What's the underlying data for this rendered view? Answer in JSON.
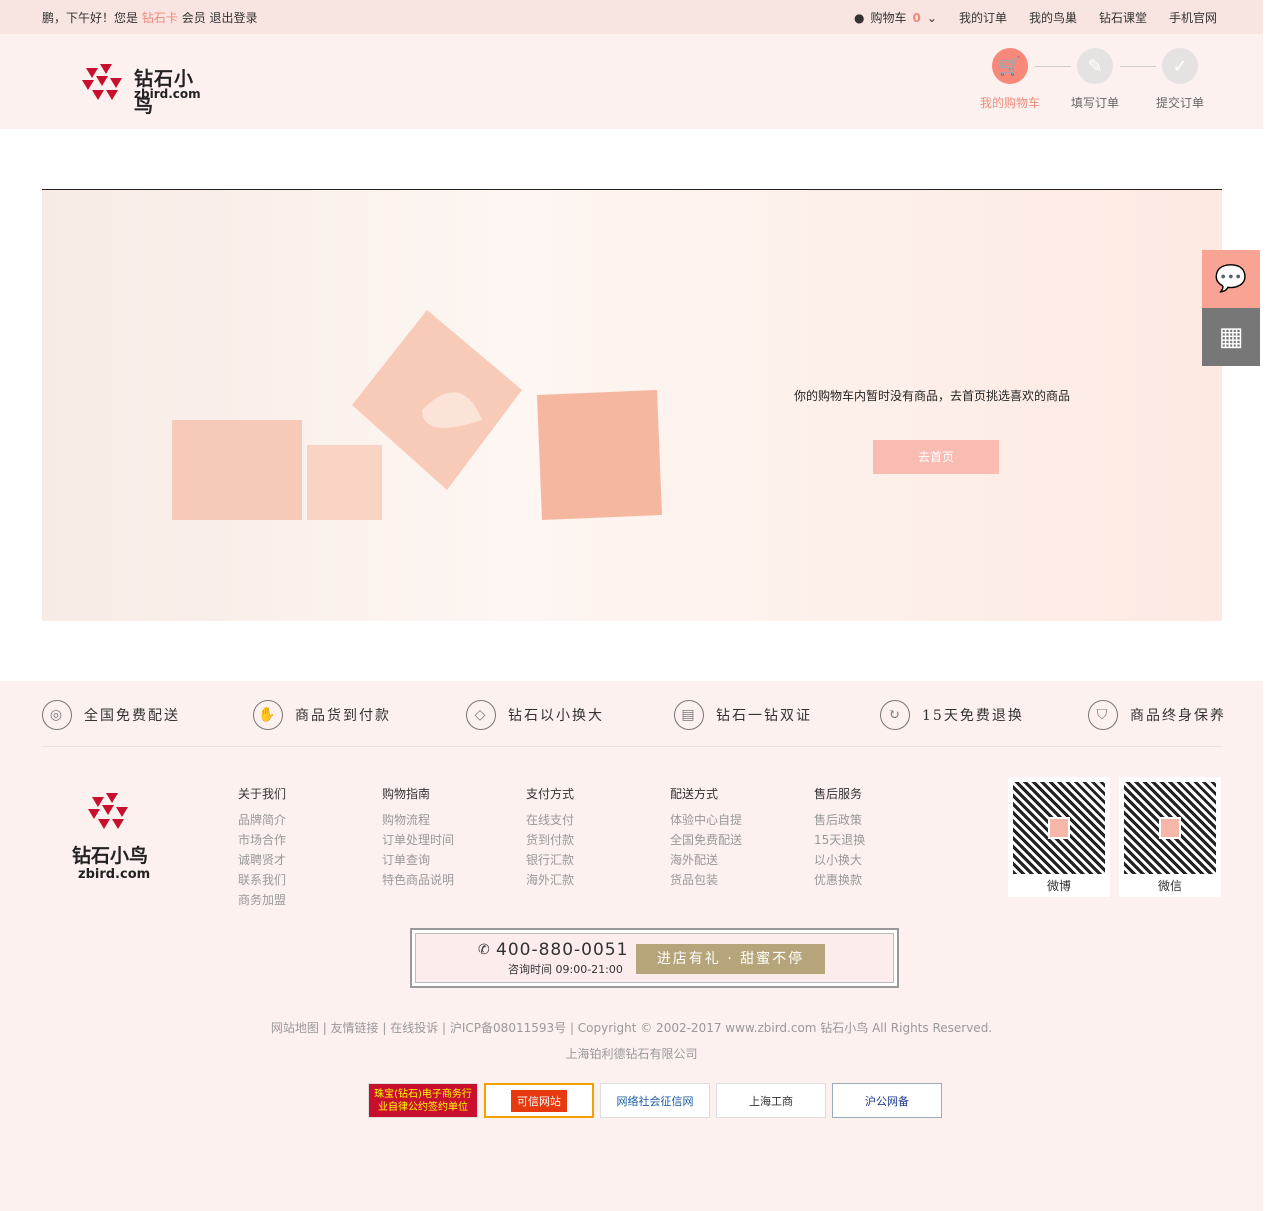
{
  "topbar": {
    "greeting": "鹏，下午好！您是",
    "card": "钻石卡",
    "member": "会员",
    "logout": "退出登录",
    "cart_label": "购物车",
    "cart_count": "0",
    "links": [
      "我的订单",
      "我的鸟巢",
      "钻石课堂",
      "手机官网"
    ]
  },
  "header": {
    "logo_text": "钻石小鸟",
    "logo_sub": "zbird.com",
    "steps": [
      "我的购物车",
      "填写订单",
      "提交订单"
    ],
    "active_step": 0
  },
  "main": {
    "empty_message": "你的购物车内暂时没有商品，去首页挑选喜欢的商品",
    "home_button": "去首页"
  },
  "footer": {
    "features": [
      "全国免费配送",
      "商品货到付款",
      "钻石以小换大",
      "钻石一钻双证",
      "15天免费退换",
      "商品终身保养"
    ],
    "columns": [
      {
        "title": "关于我们",
        "items": [
          "品牌简介",
          "市场合作",
          "诚聘贤才",
          "联系我们",
          "商务加盟"
        ]
      },
      {
        "title": "购物指南",
        "items": [
          "购物流程",
          "订单处理时间",
          "订单查询",
          "特色商品说明"
        ]
      },
      {
        "title": "支付方式",
        "items": [
          "在线支付",
          "货到付款",
          "银行汇款",
          "海外汇款"
        ]
      },
      {
        "title": "配送方式",
        "items": [
          "体验中心自提",
          "全国免费配送",
          "海外配送",
          "货品包装"
        ]
      },
      {
        "title": "售后服务",
        "items": [
          "售后政策",
          "15天退换",
          "以小换大",
          "优惠换款"
        ]
      }
    ],
    "qr_labels": [
      "微博",
      "微信"
    ],
    "hotline": "400-880-0051",
    "hours": "咨询时间 09:00-21:00",
    "gift": "进店有礼 · 甜蜜不停",
    "bottom_links": "网站地图  |  友情链接  |  在线投诉  |  沪ICP备08011593号  |  Copyright © 2002-2017 www.zbird.com 钻石小鸟 All Rights Reserved.",
    "company": "上海铂利德钻石有限公司",
    "badges": [
      "珠宝(钻石)电子商务行业自律公约签约单位",
      "可信网站",
      "网络社会征信网",
      "上海工商",
      "沪公网备"
    ]
  }
}
